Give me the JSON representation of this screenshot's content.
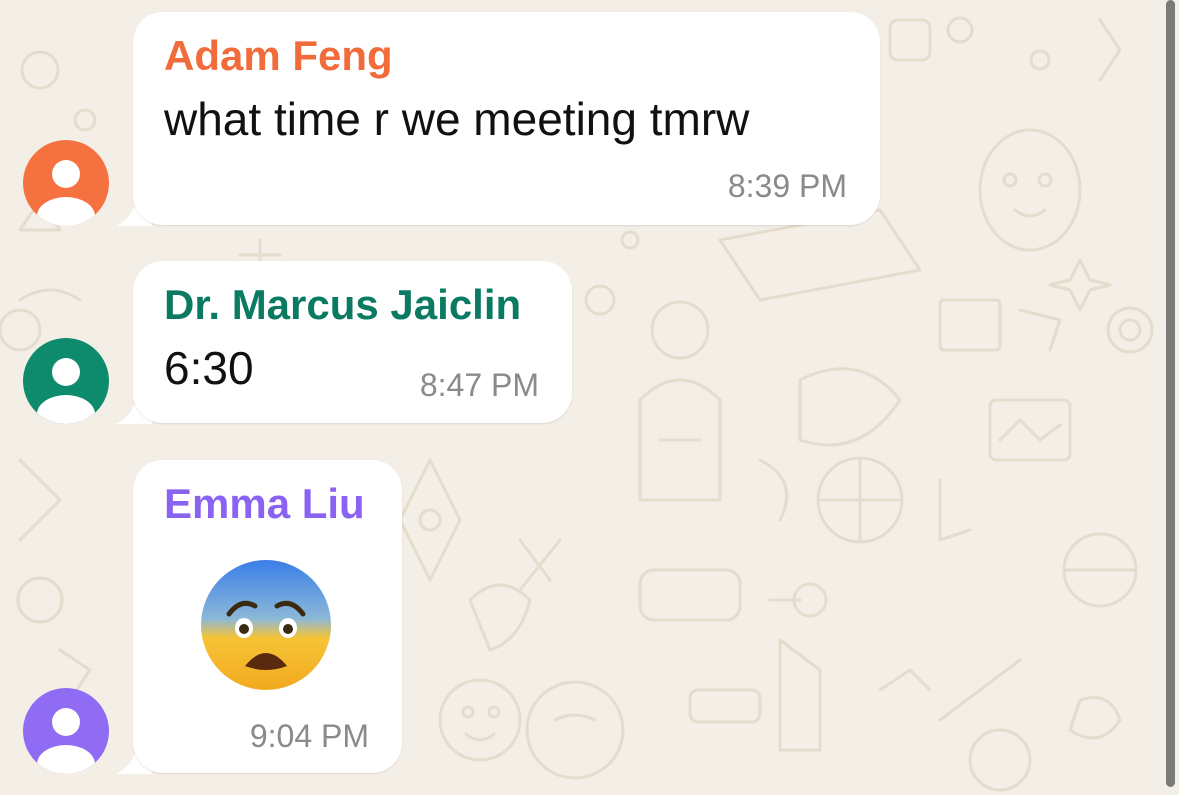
{
  "colors": {
    "wallpaper": "#f3efe7",
    "bubble": "#ffffff",
    "time_text": "#8a8a8a",
    "message_text": "#111111"
  },
  "messages": [
    {
      "sender": "Adam Feng",
      "sender_color": "#f26b3a",
      "avatar_color": "#f5713f",
      "text": "what time r we meeting tmrw",
      "time": "8:39 PM"
    },
    {
      "sender": "Dr. Marcus Jaiclin",
      "sender_color": "#0a7a62",
      "avatar_color": "#0e8a6c",
      "text": "6:30",
      "time": "8:47 PM"
    },
    {
      "sender": "Emma Liu",
      "sender_color": "#8a63f2",
      "avatar_color": "#8f6cf3",
      "sticker": "anxious-face-with-sweat-emoji",
      "time": "9:04 PM"
    }
  ]
}
